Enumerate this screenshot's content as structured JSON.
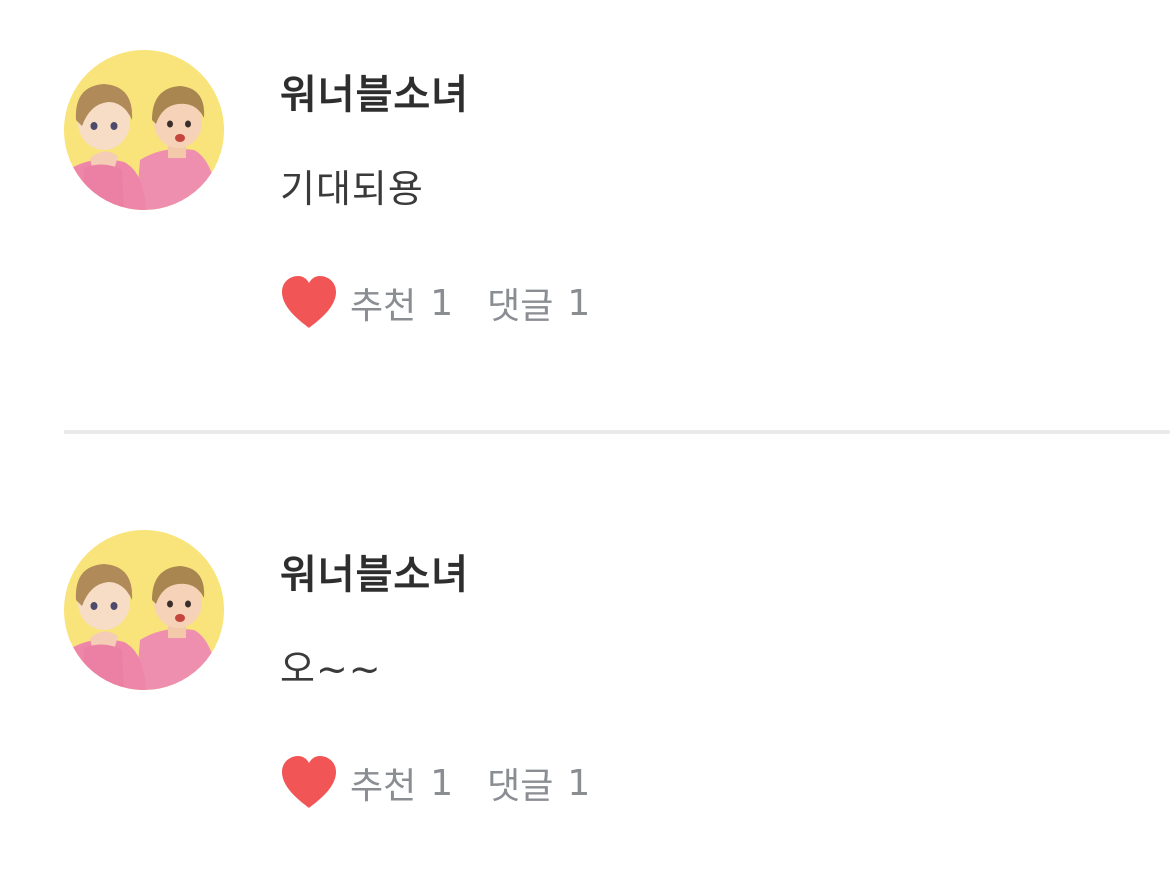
{
  "colors": {
    "heart": "#f25555",
    "meta_text": "#8a8e93",
    "author_text": "#2e2e2e",
    "divider": "#e9eaec",
    "avatar_bg": "#f8e47a"
  },
  "comments": [
    {
      "author": "워너블소녀",
      "text": "기대되용",
      "like_label": "추천",
      "like_count": "1",
      "reply_label": "댓글",
      "reply_count": "1"
    },
    {
      "author": "워너블소녀",
      "text": "오~~",
      "like_label": "추천",
      "like_count": "1",
      "reply_label": "댓글",
      "reply_count": "1"
    }
  ]
}
